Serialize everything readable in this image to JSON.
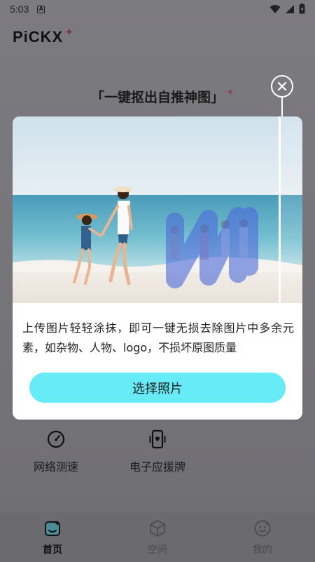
{
  "status_bar": {
    "time": "5:03",
    "notification_icon": "a-box-icon",
    "icons": [
      "wifi-icon",
      "signal-icon",
      "battery-icon"
    ]
  },
  "app": {
    "logo_text": "PiCKX",
    "banner_title": "「一键抠出自推神图」",
    "features": [
      {
        "label": "网络测速",
        "icon": "speedometer-icon"
      },
      {
        "label": "电子应援牌",
        "icon": "phone-sign-icon"
      }
    ],
    "bottom_nav": [
      {
        "label": "首页",
        "icon": "home-icon",
        "active": true
      },
      {
        "label": "空间",
        "icon": "cube-icon",
        "active": false
      },
      {
        "label": "我的",
        "icon": "face-icon",
        "active": false
      }
    ]
  },
  "modal": {
    "description": "上传图片轻轻涂抹，即可一键无损去除图片中多余元素，如杂物、人物、logo，不损坏原图质量",
    "button_label": "选择照片",
    "accent_color": "#67ebf7"
  }
}
